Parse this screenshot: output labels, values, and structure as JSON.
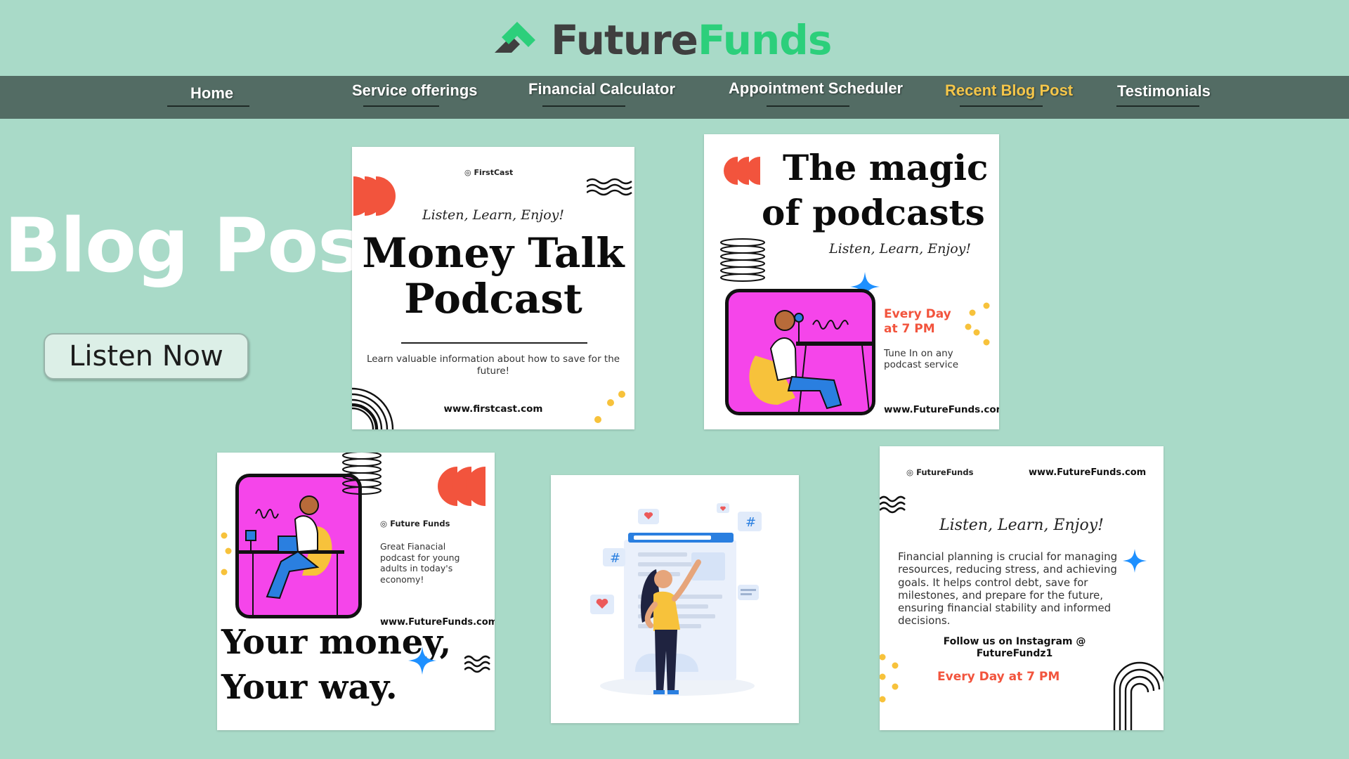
{
  "brand": {
    "name_part1": "Future",
    "name_part2": "Funds"
  },
  "nav": {
    "items": [
      {
        "label": "Home"
      },
      {
        "label": "Service offerings"
      },
      {
        "label": "Financial Calculator"
      },
      {
        "label": "Appointment Scheduler"
      },
      {
        "label": "Recent Blog Post"
      },
      {
        "label": "Testimonials"
      }
    ]
  },
  "hero": {
    "title": "Blog Post",
    "button_label": "Listen Now"
  },
  "cards": {
    "money_talk": {
      "brand": "FirstCast",
      "tagline": "Listen, Learn, Enjoy!",
      "title_line1": "Money Talk",
      "title_line2": "Podcast",
      "description": "Learn valuable information about how to save for the future!",
      "url": "www.firstcast.com"
    },
    "magic": {
      "title_line1": "The magic",
      "title_line2": "of podcasts",
      "tagline": "Listen, Learn, Enjoy!",
      "schedule_line1": "Every Day",
      "schedule_line2": "at 7 PM",
      "tune_in": "Tune In on any podcast service",
      "url": "www.FutureFunds.com"
    },
    "your_money": {
      "brand": "Future Funds",
      "description": "Great Fianacial podcast for young adults in today's economy!",
      "url": "www.FutureFunds.com",
      "title_line1": "Your money,",
      "title_line2": "Your way."
    },
    "planning": {
      "brand": "FutureFunds",
      "url": "www.FutureFunds.com",
      "tagline": "Listen, Learn, Enjoy!",
      "body": "Financial planning is crucial for managing resources, reducing stress, and achieving goals. It helps control debt, save for milestones, and prepare for the future, ensuring financial stability and informed decisions.",
      "follow": "Follow us on Instagram @ FutureFundz1",
      "schedule": "Every Day at 7 PM"
    }
  },
  "colors": {
    "background": "#a9dac8",
    "nav_bar": "#536c64",
    "nav_active": "#f4c64a",
    "brand_green": "#2ccf7b",
    "accent_red": "#f2543d",
    "accent_magenta": "#f545ea",
    "accent_orange": "#f2543d",
    "accent_blue": "#1e90ff",
    "accent_yellow": "#f7c23b"
  }
}
